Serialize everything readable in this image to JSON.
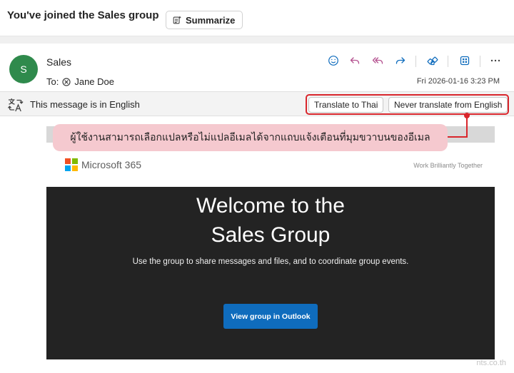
{
  "subject": "You've joined the Sales group",
  "summarize_label": "Summarize",
  "message": {
    "avatar_initial": "S",
    "sender": "Sales",
    "to_prefix": "To:",
    "to_name": "Jane Doe",
    "date": "Fri 2026-01-16 3:23 PM"
  },
  "actions": [
    "emoji-icon",
    "reply-icon",
    "reply-all-icon",
    "forward-icon",
    "apps-icon",
    "grid-icon",
    "more-icon"
  ],
  "translate_bar": {
    "text": "This message is in English",
    "translate_button": "Translate to Thai",
    "never_button": "Never translate from English"
  },
  "callout": "ผู้ใช้งานสามารถเลือกแปลหรือไม่แปลอีเมลได้จากแถบแจ้งเตือนที่มุมขวาบนของอีเมล",
  "email": {
    "brand": "Microsoft 365",
    "tagline": "Work Brilliantly Together",
    "hero_title_line1": "Welcome to the",
    "hero_title_line2": "Sales Group",
    "hero_subtitle": "Use the group to share messages and files, and to coordinate group events.",
    "cta": "View group in Outlook"
  },
  "watermark": "nts.co.th",
  "colors": {
    "avatar": "#2f8a4c",
    "accent": "#0f6cbd",
    "highlight": "#d9262c",
    "callout_bg": "#f5c9cf",
    "hero_bg": "#232323",
    "ms_red": "#f25022",
    "ms_green": "#7fba00",
    "ms_blue": "#00a4ef",
    "ms_yellow": "#ffb900"
  }
}
